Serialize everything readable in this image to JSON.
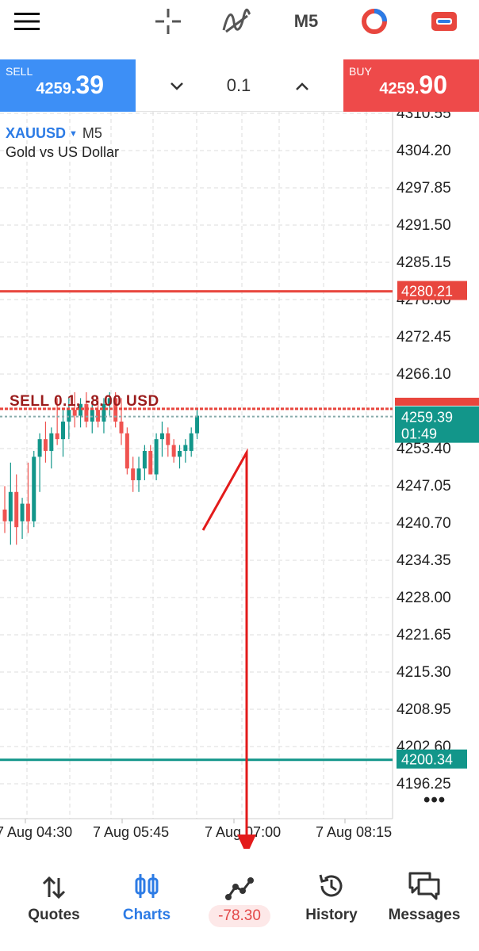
{
  "toolbar": {
    "timeframe": "M5",
    "icons": [
      "menu-icon",
      "crosshair-icon",
      "indicators-icon",
      "timeframe",
      "chart-type-icon",
      "one-click-trading-icon"
    ]
  },
  "trade": {
    "sell": {
      "label": "SELL",
      "price_small": "4259.",
      "price_big": "39"
    },
    "buy": {
      "label": "BUY",
      "price_small": "4259.",
      "price_big": "90"
    },
    "lot": "0.1"
  },
  "symbol": {
    "name": "XAUUSD",
    "timeframe": "M5",
    "description": "Gold vs US Dollar"
  },
  "chart_data": {
    "type": "candlestick",
    "y_ticks": [
      "4310.55",
      "4304.20",
      "4297.85",
      "4291.50",
      "4285.15",
      "4278.80",
      "4272.45",
      "4266.10",
      "4253.40",
      "4247.05",
      "4240.70",
      "4234.35",
      "4228.00",
      "4221.65",
      "4215.30",
      "4208.95",
      "4202.60",
      "4196.25"
    ],
    "x_ticks": [
      "7 Aug 04:30",
      "7 Aug 05:45",
      "7 Aug 07:00",
      "7 Aug 08:15"
    ],
    "ylim": [
      4195,
      4313
    ],
    "sl_line": {
      "value": 4280.21,
      "label": "4280.21",
      "color": "#e8463e"
    },
    "tp_line": {
      "value": 4200.34,
      "label": "4200.34",
      "color": "#12968a"
    },
    "bid_line": {
      "value": 4259.39,
      "label": "4259.39",
      "countdown": "01:49",
      "color": "#12968a"
    },
    "ask_line": {
      "value": 4259.9,
      "color": "#e8463e"
    },
    "order_label": "SELL 0.1, -8.00 USD",
    "up_color": "#12968a",
    "down_color": "#ef5350",
    "candles": [
      {
        "o": 4243,
        "h": 4247,
        "l": 4239,
        "c": 4241
      },
      {
        "o": 4241,
        "h": 4251,
        "l": 4237,
        "c": 4246
      },
      {
        "o": 4246,
        "h": 4249,
        "l": 4237,
        "c": 4240
      },
      {
        "o": 4241,
        "h": 4245,
        "l": 4238,
        "c": 4244
      },
      {
        "o": 4244,
        "h": 4251,
        "l": 4239,
        "c": 4241
      },
      {
        "o": 4241,
        "h": 4253,
        "l": 4240,
        "c": 4252
      },
      {
        "o": 4252,
        "h": 4256,
        "l": 4246,
        "c": 4255
      },
      {
        "o": 4255,
        "h": 4258,
        "l": 4251,
        "c": 4253
      },
      {
        "o": 4253,
        "h": 4257,
        "l": 4250,
        "c": 4256
      },
      {
        "o": 4256,
        "h": 4262,
        "l": 4254,
        "c": 4255
      },
      {
        "o": 4255,
        "h": 4260,
        "l": 4252,
        "c": 4258
      },
      {
        "o": 4258,
        "h": 4262,
        "l": 4255,
        "c": 4260
      },
      {
        "o": 4260,
        "h": 4263,
        "l": 4257,
        "c": 4259
      },
      {
        "o": 4259,
        "h": 4262,
        "l": 4257,
        "c": 4261
      },
      {
        "o": 4261,
        "h": 4263,
        "l": 4257,
        "c": 4258
      },
      {
        "o": 4258,
        "h": 4261,
        "l": 4256,
        "c": 4260
      },
      {
        "o": 4260,
        "h": 4262,
        "l": 4257,
        "c": 4258
      },
      {
        "o": 4258,
        "h": 4262,
        "l": 4256,
        "c": 4261
      },
      {
        "o": 4261,
        "h": 4263,
        "l": 4259,
        "c": 4262
      },
      {
        "o": 4262,
        "h": 4263,
        "l": 4257,
        "c": 4258
      },
      {
        "o": 4258,
        "h": 4262,
        "l": 4254,
        "c": 4256
      },
      {
        "o": 4256,
        "h": 4257,
        "l": 4249,
        "c": 4250
      },
      {
        "o": 4250,
        "h": 4252,
        "l": 4246,
        "c": 4248
      },
      {
        "o": 4248,
        "h": 4252,
        "l": 4246,
        "c": 4250
      },
      {
        "o": 4250,
        "h": 4254,
        "l": 4248,
        "c": 4253
      },
      {
        "o": 4253,
        "h": 4254,
        "l": 4249,
        "c": 4249
      },
      {
        "o": 4249,
        "h": 4256,
        "l": 4248,
        "c": 4255
      },
      {
        "o": 4255,
        "h": 4258,
        "l": 4252,
        "c": 4256
      },
      {
        "o": 4256,
        "h": 4257,
        "l": 4252,
        "c": 4254
      },
      {
        "o": 4254,
        "h": 4255,
        "l": 4251,
        "c": 4252
      },
      {
        "o": 4252,
        "h": 4254,
        "l": 4250,
        "c": 4253
      },
      {
        "o": 4253,
        "h": 4255,
        "l": 4251,
        "c": 4254
      },
      {
        "o": 4253,
        "h": 4257,
        "l": 4252,
        "c": 4256
      },
      {
        "o": 4256,
        "h": 4260,
        "l": 4255,
        "c": 4259
      }
    ]
  },
  "nav": {
    "items": [
      {
        "label": "Quotes",
        "icon": "quotes-arrows-icon"
      },
      {
        "label": "Charts",
        "icon": "charts-candles-icon"
      },
      {
        "label": "-78.30",
        "icon": "trade-icon"
      },
      {
        "label": "History",
        "icon": "history-icon"
      },
      {
        "label": "Messages",
        "icon": "messages-icon"
      }
    ]
  }
}
